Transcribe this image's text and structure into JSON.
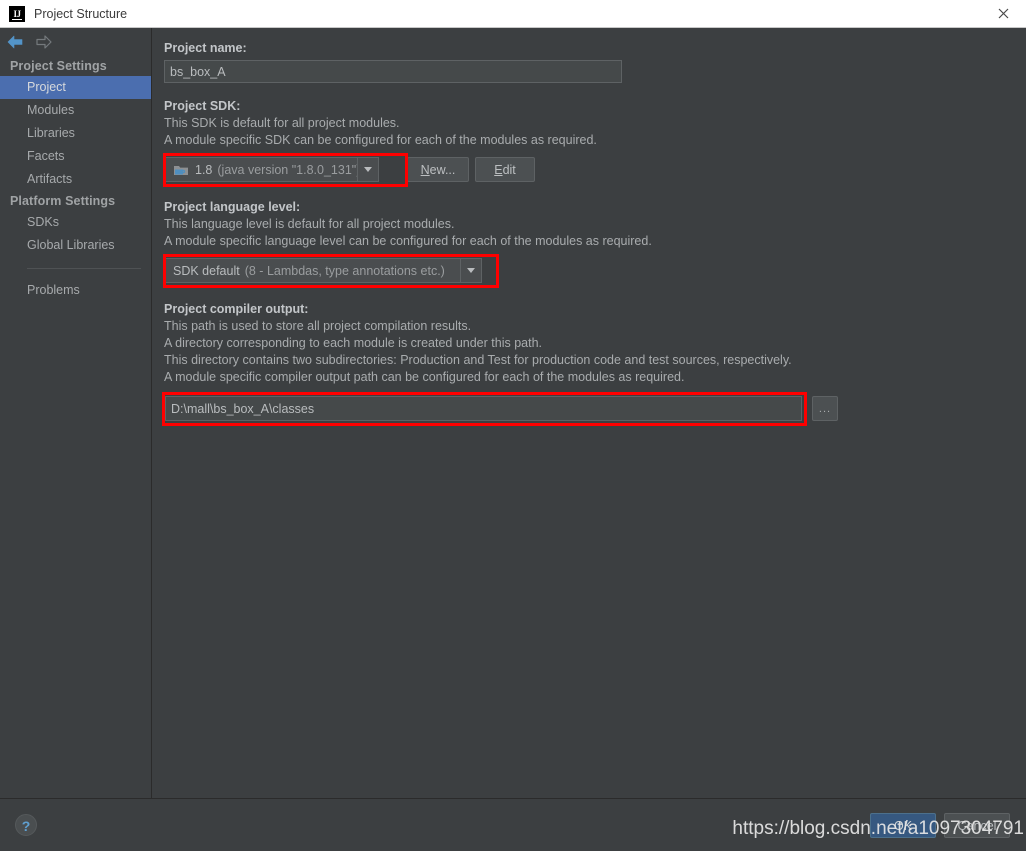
{
  "window": {
    "title": "Project Structure",
    "logo_text": "IJ",
    "close_icon": "close-icon"
  },
  "nav": {
    "back_icon": "arrow-left-icon",
    "forward_icon": "arrow-right-icon",
    "back_color": "#5394c8",
    "forward_color": "#6e7376"
  },
  "sidebar": {
    "groups": [
      {
        "label": "Project Settings",
        "items": [
          {
            "label": "Project",
            "selected": true
          },
          {
            "label": "Modules",
            "selected": false
          },
          {
            "label": "Libraries",
            "selected": false
          },
          {
            "label": "Facets",
            "selected": false
          },
          {
            "label": "Artifacts",
            "selected": false
          }
        ]
      },
      {
        "label": "Platform Settings",
        "items": [
          {
            "label": "SDKs",
            "selected": false
          },
          {
            "label": "Global Libraries",
            "selected": false
          }
        ]
      }
    ],
    "problems_label": "Problems",
    "selection_color": "#4b6eaf"
  },
  "main": {
    "project_name": {
      "label": "Project name:",
      "value": "bs_box_A",
      "placeholder": ""
    },
    "project_sdk": {
      "label": "Project SDK:",
      "desc_lines": [
        "This SDK is default for all project modules.",
        "A module specific SDK can be configured for each of the modules as required."
      ],
      "selected_name": "1.8",
      "selected_detail": "(java version \"1.8.0_131\")",
      "sdk_icon": "java-sdk-folder-icon",
      "new_button": "New...",
      "new_button_mnemonic": "N",
      "edit_button": "Edit",
      "edit_button_mnemonic": "E"
    },
    "language_level": {
      "label": "Project language level:",
      "desc_lines": [
        "This language level is default for all project modules.",
        "A module specific language level can be configured for each of the modules as required."
      ],
      "selected_name": "SDK default",
      "selected_detail": "(8 - Lambdas, type annotations etc.)"
    },
    "compiler_output": {
      "label": "Project compiler output:",
      "desc_lines": [
        "This path is used to store all project compilation results.",
        "A directory corresponding to each module is created under this path.",
        "This directory contains two subdirectories: Production and Test for production code and test sources, respectively.",
        "A module specific compiler output path can be configured for each of the modules as required."
      ],
      "value": "D:\\mall\\bs_box_A\\classes",
      "placeholder": "",
      "browse_button": "...",
      "browse_icon": "browse-ellipsis-icon"
    }
  },
  "annotations": {
    "highlight_color": "#ff0000",
    "boxes": [
      {
        "name": "sdk-combo-highlight"
      },
      {
        "name": "language-level-combo-highlight"
      },
      {
        "name": "compiler-output-highlight"
      }
    ]
  },
  "footer": {
    "help_icon": "help-question-icon",
    "help_glyph": "?",
    "ok_button": "OK",
    "cancel_button": "Cancel",
    "ok_color": "#365880"
  },
  "watermark": {
    "text": "https://blog.csdn.net/a1097304791"
  }
}
